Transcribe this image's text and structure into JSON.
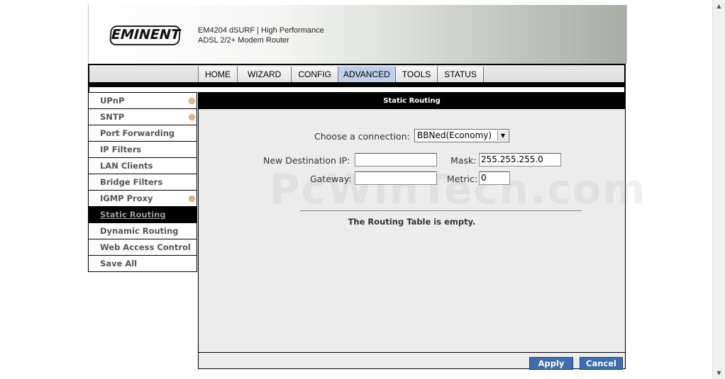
{
  "brand": {
    "logo_text": "EMINENT",
    "model_line1": "EM4204 dSURF | High Performance",
    "model_line2": "ADSL 2/2+ Modem Router"
  },
  "nav": {
    "tabs": [
      {
        "label": "HOME"
      },
      {
        "label": "WIZARD"
      },
      {
        "label": "CONFIG"
      },
      {
        "label": "ADVANCED",
        "active": true
      },
      {
        "label": "TOOLS"
      },
      {
        "label": "STATUS"
      }
    ]
  },
  "sidebar": {
    "items": [
      {
        "label": "UPnP",
        "has_indicator": true
      },
      {
        "label": "SNTP",
        "has_indicator": true
      },
      {
        "label": "Port Forwarding"
      },
      {
        "label": "IP Filters"
      },
      {
        "label": "LAN Clients"
      },
      {
        "label": "Bridge Filters"
      },
      {
        "label": "IGMP Proxy",
        "has_indicator": true
      },
      {
        "label": "Static Routing",
        "active": true
      },
      {
        "label": "Dynamic Routing"
      },
      {
        "label": "Web Access Control"
      },
      {
        "label": "Save All"
      }
    ]
  },
  "main": {
    "title": "Static Routing",
    "connection_label": "Choose a connection:",
    "connection_value": "BBNed(Economy)",
    "dest_ip_label": "New Destination IP:",
    "dest_ip_value": "",
    "mask_label": "Mask:",
    "mask_value": "255.255.255.0",
    "gateway_label": "Gateway:",
    "gateway_value": "",
    "metric_label": "Metric:",
    "metric_value": "0",
    "empty_message": "The Routing Table is empty.",
    "apply_label": "Apply",
    "cancel_label": "Cancel"
  },
  "watermark": "PcWinTech.com",
  "colors": {
    "active_tab": "#bed0ec",
    "button_bg": "#3d6db3",
    "header_bar": "#000000",
    "content_bg": "#ececec"
  },
  "icons": {
    "sidebar_indicator": "orange-dot-icon",
    "dropdown": "chevron-down-icon",
    "scroll_up": "scroll-up-arrow-icon",
    "scroll_down": "scroll-down-arrow-icon"
  }
}
